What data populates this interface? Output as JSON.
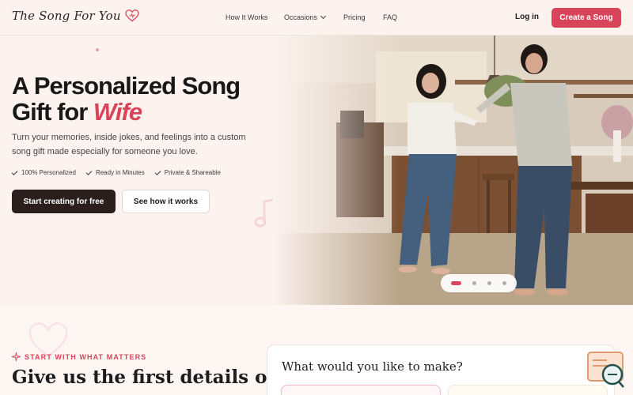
{
  "nav": {
    "brand": "The Song For You",
    "links": [
      "How It Works",
      "Occasions",
      "Pricing",
      "FAQ"
    ],
    "login": "Log in",
    "cta": "Create a Song"
  },
  "hero": {
    "title_line1": "A Personalized Song",
    "title_line2_prefix": "Gift for ",
    "title_accent": "Wife",
    "subtitle": "Turn your memories, inside jokes, and feelings into a custom song gift made especially for someone you love.",
    "features": [
      "100% Personalized",
      "Ready in Minutes",
      "Private & Shareable"
    ],
    "primary_button": "Start creating for free",
    "secondary_button": "See how it works",
    "carousel": {
      "slides": 4,
      "active": 1
    }
  },
  "section": {
    "kicker": "START WITH WHAT MATTERS",
    "title": "Give us the first details of",
    "card_title": "What would you like to make?"
  },
  "colors": {
    "accent": "#d8445a",
    "dark_button": "#2a1f1c",
    "background": "#fcf2ee"
  },
  "icons": [
    "heart-icon",
    "chevron-down-icon",
    "check-icon",
    "music-note-icon",
    "sparkle-icon",
    "chat-support-icon"
  ]
}
